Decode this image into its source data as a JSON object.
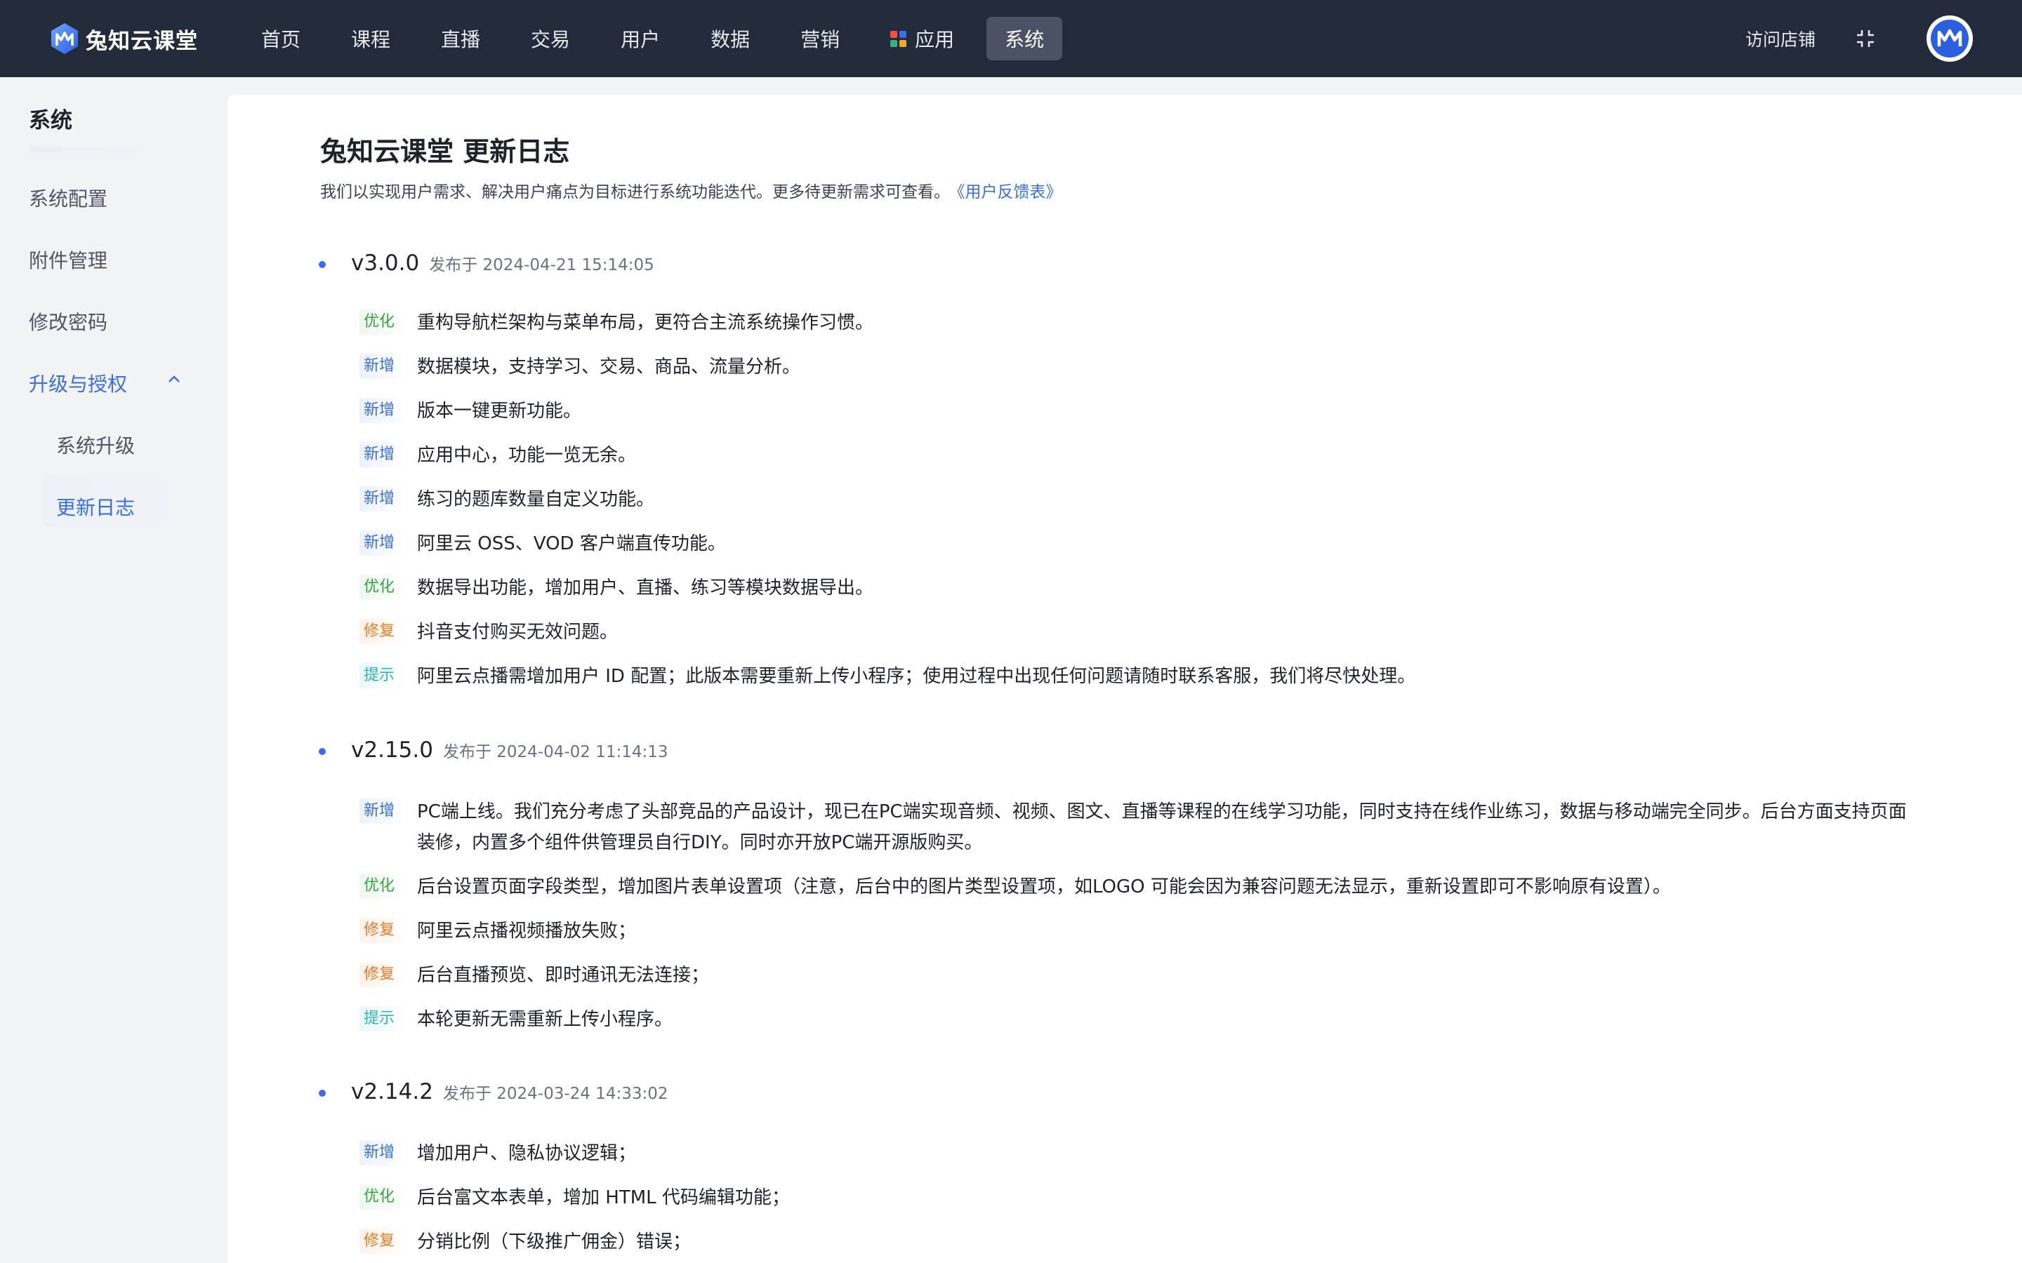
{
  "topbar": {
    "brand_name": "兔知云课堂",
    "nav": [
      {
        "label": "首页",
        "active": false
      },
      {
        "label": "课程",
        "active": false
      },
      {
        "label": "直播",
        "active": false
      },
      {
        "label": "交易",
        "active": false
      },
      {
        "label": "用户",
        "active": false
      },
      {
        "label": "数据",
        "active": false
      },
      {
        "label": "营销",
        "active": false
      },
      {
        "label": "应用",
        "active": false,
        "icon": "apps-grid-icon"
      },
      {
        "label": "系统",
        "active": true
      }
    ],
    "visit_store": "访问店铺",
    "fullscreen_icon": "exit-fullscreen-icon",
    "avatar_icon": "user-avatar-logo-icon"
  },
  "sidebar": {
    "title": "系统",
    "items": [
      {
        "label": "系统配置"
      },
      {
        "label": "附件管理"
      },
      {
        "label": "修改密码"
      }
    ],
    "group": {
      "label": "升级与授权",
      "expanded": true,
      "children": [
        {
          "label": "系统升级",
          "active": false
        },
        {
          "label": "更新日志",
          "active": true
        }
      ]
    }
  },
  "main": {
    "title": "兔知云课堂 更新日志",
    "description": "我们以实现用户需求、解决用户痛点为目标进行系统功能迭代。更多待更新需求可查看。",
    "feedback_link": "《用户反馈表》",
    "releases": [
      {
        "version": "v3.0.0",
        "date": "发布于 2024-04-21 15:14:05",
        "entries": [
          {
            "tag": "优化",
            "type": "opt",
            "text": "重构导航栏架构与菜单布局，更符合主流系统操作习惯。"
          },
          {
            "tag": "新增",
            "type": "new",
            "text": "数据模块，支持学习、交易、商品、流量分析。"
          },
          {
            "tag": "新增",
            "type": "new",
            "text": "版本一键更新功能。"
          },
          {
            "tag": "新增",
            "type": "new",
            "text": "应用中心，功能一览无余。"
          },
          {
            "tag": "新增",
            "type": "new",
            "text": "练习的题库数量自定义功能。"
          },
          {
            "tag": "新增",
            "type": "new",
            "text": "阿里云 OSS、VOD 客户端直传功能。"
          },
          {
            "tag": "优化",
            "type": "opt",
            "text": "数据导出功能，增加用户、直播、练习等模块数据导出。"
          },
          {
            "tag": "修复",
            "type": "fix",
            "text": "抖音支付购买无效问题。"
          },
          {
            "tag": "提示",
            "type": "tip",
            "text": "阿里云点播需增加用户 ID 配置；此版本需要重新上传小程序；使用过程中出现任何问题请随时联系客服，我们将尽快处理。"
          }
        ]
      },
      {
        "version": "v2.15.0",
        "date": "发布于 2024-04-02 11:14:13",
        "entries": [
          {
            "tag": "新增",
            "type": "new",
            "text": "PC端上线。我们充分考虑了头部竞品的产品设计，现已在PC端实现音频、视频、图文、直播等课程的在线学习功能，同时支持在线作业练习，数据与移动端完全同步。后台方面支持页面装修，内置多个组件供管理员自行DIY。同时亦开放PC端开源版购买。"
          },
          {
            "tag": "优化",
            "type": "opt",
            "text": "后台设置页面字段类型，增加图片表单设置项（注意，后台中的图片类型设置项，如LOGO 可能会因为兼容问题无法显示，重新设置即可不影响原有设置）。"
          },
          {
            "tag": "修复",
            "type": "fix",
            "text": "阿里云点播视频播放失败；"
          },
          {
            "tag": "修复",
            "type": "fix",
            "text": "后台直播预览、即时通讯无法连接；"
          },
          {
            "tag": "提示",
            "type": "tip",
            "text": "本轮更新无需重新上传小程序。"
          }
        ]
      },
      {
        "version": "v2.14.2",
        "date": "发布于 2024-03-24 14:33:02",
        "entries": [
          {
            "tag": "新增",
            "type": "new",
            "text": "增加用户、隐私协议逻辑；"
          },
          {
            "tag": "优化",
            "type": "opt",
            "text": "后台富文本表单，增加 HTML 代码编辑功能；"
          },
          {
            "tag": "修复",
            "type": "fix",
            "text": "分销比例（下级推广佣金）错误；"
          }
        ]
      }
    ]
  },
  "colors": {
    "topbar_bg": "#232a3a",
    "accent": "#3a6ee8",
    "tag_opt": "#2fa83a",
    "tag_new": "#3a6ee8",
    "tag_fix": "#f07a22",
    "tag_tip": "#2bb7b7"
  }
}
